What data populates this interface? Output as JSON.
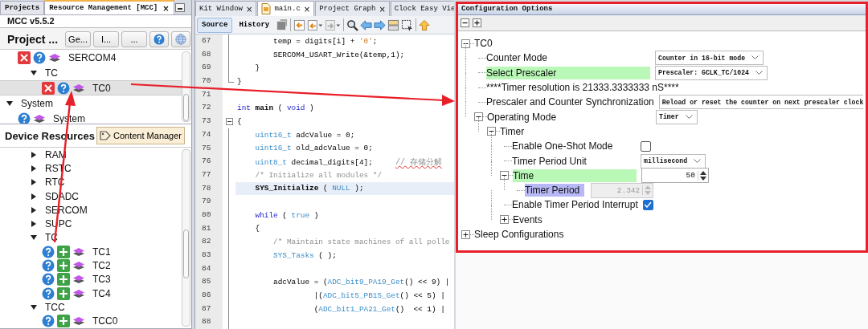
{
  "left_panel": {
    "tabs": [
      {
        "label": "Projects",
        "selected": false
      },
      {
        "label": "Resource Management [MCC]",
        "selected": true,
        "close": "×"
      }
    ],
    "version": "MCC v5.5.2",
    "project_resources": {
      "title": "Project ...",
      "buttons": [
        "Ge...",
        "I...",
        "..."
      ],
      "tree": [
        {
          "kind": "continued",
          "children": [
            {
              "kind": "component",
              "label": "SERCOM4",
              "removable": true,
              "selected": false
            },
            {
              "kind": "group",
              "label": "TC",
              "expanded": true,
              "children": [
                {
                  "kind": "component",
                  "label": "TC0",
                  "removable": true,
                  "selected": true
                }
              ]
            }
          ]
        },
        {
          "kind": "group",
          "label": "System",
          "expanded": true,
          "children": [
            {
              "kind": "component",
              "label": "System",
              "selected": false
            }
          ]
        }
      ]
    },
    "device_resources": {
      "title": "Device Resources",
      "button": "Content Manager",
      "tree": [
        {
          "kind": "continued",
          "children": [
            {
              "kind": "group",
              "label": "RAM",
              "expanded": false
            },
            {
              "kind": "group",
              "label": "RSTC",
              "expanded": false
            },
            {
              "kind": "group",
              "label": "RTC",
              "expanded": false
            },
            {
              "kind": "group",
              "label": "SDADC",
              "expanded": false
            },
            {
              "kind": "group",
              "label": "SERCOM",
              "expanded": false
            },
            {
              "kind": "group",
              "label": "SUPC",
              "expanded": false
            },
            {
              "kind": "group",
              "label": "TC",
              "expanded": true,
              "children": [
                {
                  "kind": "component",
                  "label": "TC1",
                  "addable": true,
                  "selected": false
                },
                {
                  "kind": "component",
                  "label": "TC2",
                  "addable": true,
                  "selected": false
                },
                {
                  "kind": "component",
                  "label": "TC3",
                  "addable": true,
                  "selected": false
                },
                {
                  "kind": "component",
                  "label": "TC4",
                  "addable": true,
                  "selected": false
                }
              ]
            },
            {
              "kind": "group",
              "label": "TCC",
              "expanded": true,
              "children": [
                {
                  "kind": "component",
                  "label": "TCC0",
                  "addable": true,
                  "selected": false
                }
              ]
            }
          ]
        }
      ]
    }
  },
  "editor": {
    "tabs": [
      {
        "label": "Kit Window",
        "selected": false,
        "close": "×"
      },
      {
        "label": "main.c",
        "selected": true,
        "file_icon": true,
        "close": "×"
      },
      {
        "label": "Project Graph",
        "selected": false,
        "close": "×"
      },
      {
        "label": "Clock Easy Vie",
        "selected": false
      }
    ],
    "views": [
      {
        "label": "Source",
        "selected": true
      },
      {
        "label": "History",
        "selected": false
      }
    ],
    "lines": [
      {
        "num": "67",
        "kind": "guide",
        "current": false,
        "parts": [
          {
            "text": "        temp = digits[i] + ",
            "kind": "plain"
          },
          {
            "text": "'0'",
            "kind": "string"
          },
          {
            "text": ";",
            "kind": "plain"
          }
        ]
      },
      {
        "num": "68",
        "kind": "guide",
        "current": false,
        "parts": [
          {
            "text": "        SERCOM4_USART_Write(&temp,1);",
            "kind": "plain"
          }
        ]
      },
      {
        "num": "69",
        "kind": "guide",
        "current": false,
        "parts": [
          {
            "text": "    }",
            "kind": "plain"
          }
        ]
      },
      {
        "num": "70",
        "kind": "end",
        "current": false,
        "parts": [
          {
            "text": "}",
            "kind": "plain"
          }
        ]
      },
      {
        "num": "71",
        "kind": "plain",
        "current": false
      },
      {
        "num": "72",
        "kind": "plain",
        "current": false,
        "parts": [
          {
            "text": "int",
            "kind": "keyword"
          },
          {
            "text": " main",
            "kind": "bold"
          },
          {
            "text": " ( ",
            "kind": "plain"
          },
          {
            "text": "void",
            "kind": "keyword"
          },
          {
            "text": " )",
            "kind": "plain"
          }
        ]
      },
      {
        "num": "73",
        "kind": "start",
        "current": false,
        "parts": [
          {
            "text": "{",
            "kind": "plain"
          }
        ]
      },
      {
        "num": "74",
        "kind": "guide",
        "current": false,
        "parts": [
          {
            "text": "    uint16_t",
            "kind": "type"
          },
          {
            "text": " adcValue = 0;",
            "kind": "plain"
          }
        ]
      },
      {
        "num": "75",
        "kind": "guide",
        "current": false,
        "parts": [
          {
            "text": "    uint16_t",
            "kind": "type"
          },
          {
            "text": " old_adcValue = 0;",
            "kind": "plain"
          }
        ]
      },
      {
        "num": "76",
        "kind": "guide",
        "current": false,
        "parts": [
          {
            "text": "    uint8_t",
            "kind": "type"
          },
          {
            "text": " decimal_digits[4];     ",
            "kind": "plain"
          },
          {
            "text": "// 存储分解",
            "kind": "comment",
            "misspelled": true
          }
        ]
      },
      {
        "num": "77",
        "kind": "guide",
        "current": false,
        "parts": [
          {
            "text": "    /* Initialize all modules */",
            "kind": "comment"
          }
        ]
      },
      {
        "num": "78",
        "kind": "guide",
        "current": true,
        "parts": [
          {
            "text": "    SYS_Initialize",
            "kind": "bold"
          },
          {
            "text": " ( ",
            "kind": "plain"
          },
          {
            "text": "NULL",
            "kind": "call"
          },
          {
            "text": " );",
            "kind": "plain"
          }
        ]
      },
      {
        "num": "79",
        "kind": "guide",
        "current": false
      },
      {
        "num": "80",
        "kind": "guide",
        "current": false,
        "parts": [
          {
            "text": "    while",
            "kind": "keyword"
          },
          {
            "text": " ( ",
            "kind": "plain"
          },
          {
            "text": "true",
            "kind": "call"
          },
          {
            "text": " )",
            "kind": "plain"
          }
        ]
      },
      {
        "num": "81",
        "kind": "guide",
        "current": false,
        "parts": [
          {
            "text": "    {",
            "kind": "plain"
          }
        ]
      },
      {
        "num": "82",
        "kind": "guide",
        "current": false,
        "parts": [
          {
            "text": "        /* Maintain state machines of all polle",
            "kind": "comment"
          }
        ]
      },
      {
        "num": "83",
        "kind": "guide",
        "current": false,
        "parts": [
          {
            "text": "        SYS_Tasks",
            "kind": "call"
          },
          {
            "text": " ( );",
            "kind": "plain"
          }
        ]
      },
      {
        "num": "84",
        "kind": "guide",
        "current": false
      },
      {
        "num": "85",
        "kind": "guide",
        "current": false,
        "parts": [
          {
            "text": "        adcValue = (",
            "kind": "plain"
          },
          {
            "text": "ADC_bit9_PA19_Get",
            "kind": "call"
          },
          {
            "text": "() << 9) |",
            "kind": "plain"
          }
        ]
      },
      {
        "num": "86",
        "kind": "guide",
        "current": false,
        "parts": [
          {
            "text": "                 |(",
            "kind": "plain"
          },
          {
            "text": "ADC_bit5_PB15_Get",
            "kind": "call"
          },
          {
            "text": "() << 5) |",
            "kind": "plain"
          }
        ]
      },
      {
        "num": "87",
        "kind": "guide",
        "current": false,
        "parts": [
          {
            "text": "                 (",
            "kind": "plain"
          },
          {
            "text": "ADC_bit1_PA21_Get",
            "kind": "call"
          },
          {
            "text": "()  << 1) |",
            "kind": "plain"
          }
        ]
      },
      {
        "num": "88",
        "kind": "guide",
        "current": false
      }
    ]
  },
  "configuration": {
    "title": "Configuration Options",
    "tree": [
      {
        "label": "TC0",
        "kind": "group",
        "expanded": true,
        "children": [
          {
            "label": "Counter Mode",
            "kind": "setting",
            "control": {
              "kind": "combo",
              "value": "Counter in 16-bit mode"
            }
          },
          {
            "label": "Select Prescaler",
            "kind": "setting",
            "color": "#b9f8b6",
            "control": {
              "kind": "combo",
              "value": "Prescaler: GCLK_TC/1024"
            }
          },
          {
            "label": "****Timer resolution is 21333.3333333 nS****",
            "kind": "info"
          },
          {
            "label": "Prescaler and Counter Synchronization",
            "kind": "setting",
            "control": {
              "kind": "combo",
              "value": "Reload or reset the counter on next prescaler clock",
              "cut": true
            }
          },
          {
            "label": "Operating Mode",
            "kind": "group",
            "expanded": true,
            "control": {
              "kind": "combo",
              "value": "Timer"
            },
            "children": [
              {
                "label": "Timer",
                "kind": "group",
                "expanded": true,
                "children": [
                  {
                    "label": "Enable One-Shot Mode",
                    "kind": "setting",
                    "control": {
                      "kind": "checkbox",
                      "checked": false
                    }
                  },
                  {
                    "label": "Timer Period Unit",
                    "kind": "setting",
                    "control": {
                      "kind": "combo",
                      "value": "millisecond"
                    }
                  },
                  {
                    "label": "Time",
                    "kind": "group",
                    "expanded": true,
                    "color": "#b9f8b6",
                    "control": {
                      "kind": "spinner",
                      "value": "50",
                      "disabled": false
                    },
                    "children": [
                      {
                        "label": "Timer Period",
                        "kind": "setting",
                        "color": "#b8b8f6",
                        "control": {
                          "kind": "spinner",
                          "value": "2.342",
                          "disabled": true
                        }
                      }
                    ]
                  },
                  {
                    "label": "Enable Timer Period Interrupt",
                    "kind": "setting",
                    "control": {
                      "kind": "checkbox",
                      "checked": true
                    }
                  },
                  {
                    "label": "Events",
                    "kind": "group",
                    "expanded": false
                  }
                ]
              }
            ]
          }
        ]
      },
      {
        "label": "Sleep Configurations",
        "kind": "group",
        "expanded": false
      }
    ]
  }
}
